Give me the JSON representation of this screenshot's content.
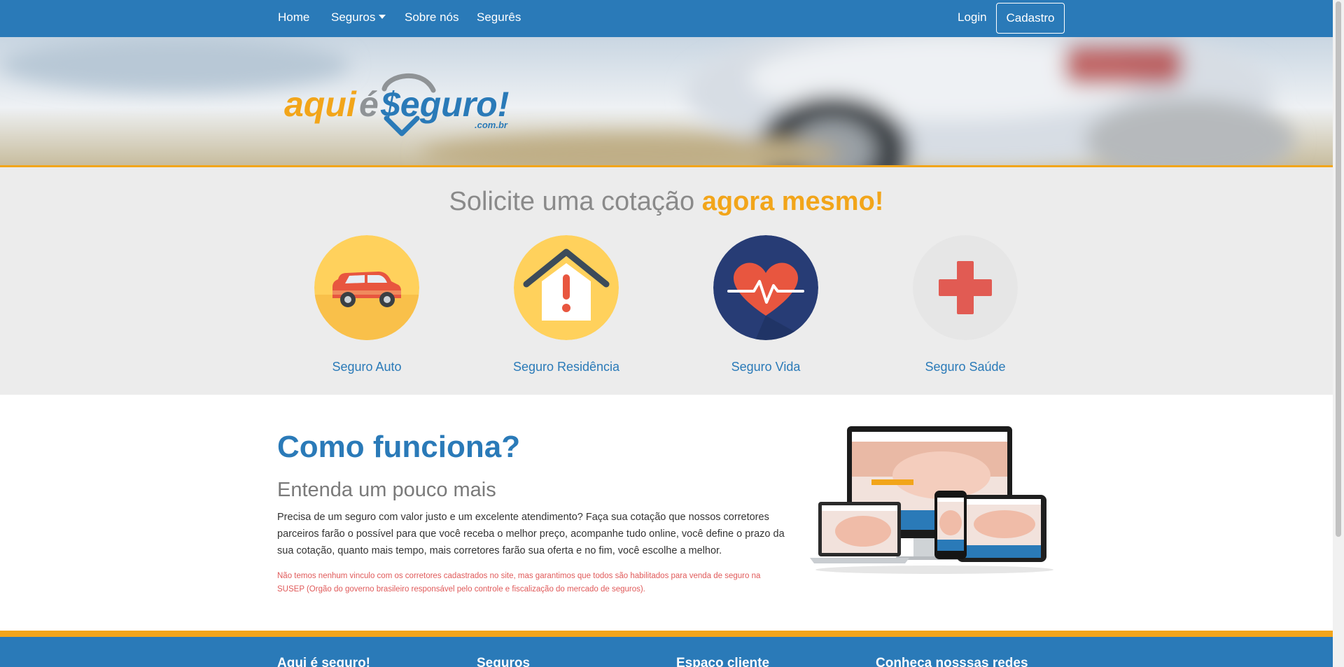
{
  "nav": {
    "links": [
      {
        "label": "Home"
      },
      {
        "label": "Seguros"
      },
      {
        "label": "Sobre nós"
      },
      {
        "label": "Segurês"
      }
    ],
    "login_label": "Login",
    "signup_label": "Cadastro"
  },
  "logo": {
    "text_aqui": "aqui",
    "text_e": "é",
    "text_seguro": "$eguro!",
    "domain": ".com.br"
  },
  "quote": {
    "title_main": "Solicite uma cotação",
    "title_accent": "agora mesmo!",
    "items": [
      {
        "label": "Seguro Auto",
        "icon": "car-icon"
      },
      {
        "label": "Seguro Residência",
        "icon": "house-alert-icon"
      },
      {
        "label": "Seguro Vida",
        "icon": "heart-pulse-icon"
      },
      {
        "label": "Seguro Saúde",
        "icon": "medical-cross-icon"
      }
    ]
  },
  "how": {
    "title": "Como funciona?",
    "subtitle": "Entenda um pouco mais",
    "text": "Precisa de um seguro com valor justo e um excelente atendimento? Faça sua cotação que nossos corretores parceiros farão o possível para que você receba o melhor preço, acompanhe tudo online, você define o prazo da sua cotação, quanto mais tempo, mais corretores farão sua oferta e no fim, você escolhe a melhor.",
    "disclaimer": "Não temos nenhum vinculo com os corretores cadastrados no site, mas garantimos que todos são habilitados para venda de seguro na SUSEP (Orgão do governo brasileiro responsável pelo controle e fiscalização do mercado de seguros)."
  },
  "footer": {
    "columns": [
      {
        "label": "Aqui é seguro!"
      },
      {
        "label": "Seguros"
      },
      {
        "label": "Espaço cliente"
      },
      {
        "label": "Conheça nosssas redes"
      }
    ]
  },
  "colors": {
    "primary": "#2a7ab8",
    "accent": "#f2a51a",
    "section_bg": "#ececec",
    "disclaimer": "#e05a5a"
  }
}
